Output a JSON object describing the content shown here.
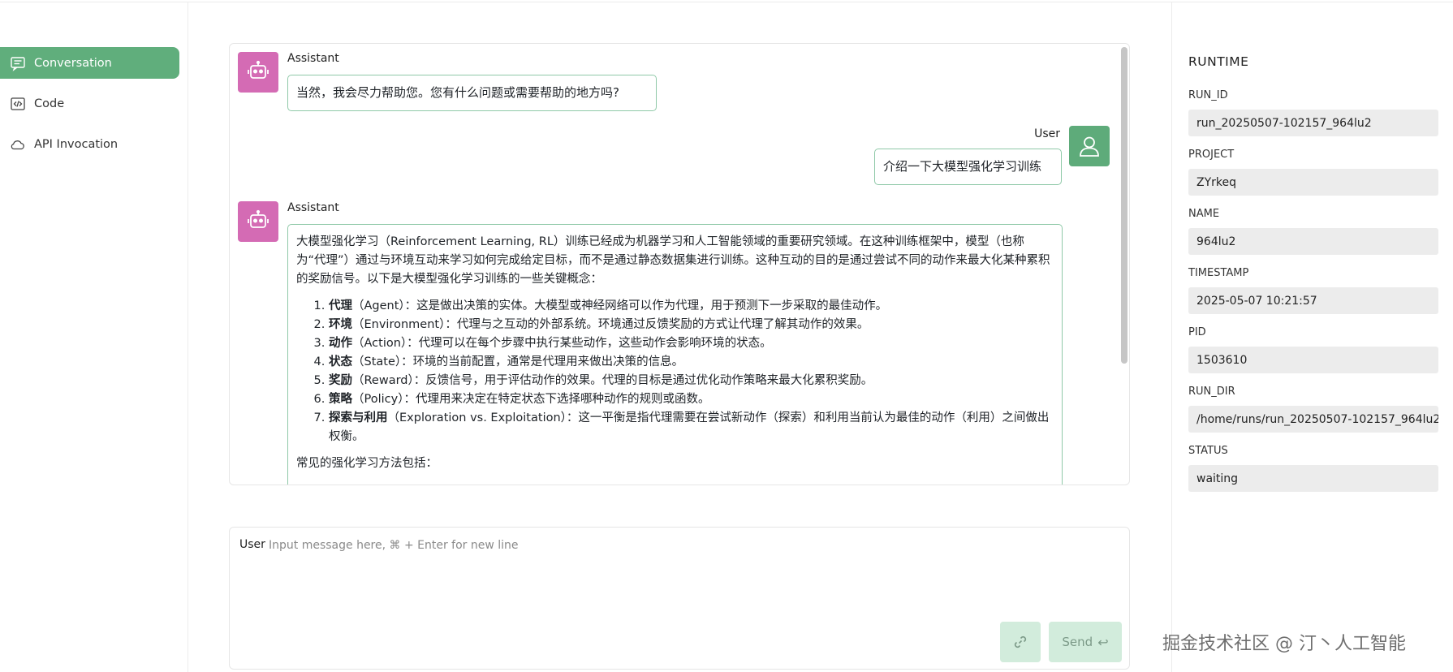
{
  "nav": {
    "items": [
      {
        "label": "Conversation",
        "icon": "chat-icon",
        "active": true
      },
      {
        "label": "Code",
        "icon": "code-icon",
        "active": false
      },
      {
        "label": "API Invocation",
        "icon": "cloud-icon",
        "active": false
      }
    ]
  },
  "chat": {
    "messages": [
      {
        "role": "Assistant",
        "text": "当然，我会尽力帮助您。您有什么问题或需要帮助的地方吗?"
      },
      {
        "role": "User",
        "text": "介绍一下大模型强化学习训练"
      },
      {
        "role": "Assistant",
        "intro": "大模型强化学习（Reinforcement Learning, RL）训练已经成为机器学习和人工智能领域的重要研究领域。在这种训练框架中，模型（也称为“代理”）通过与环境互动来学习如何完成给定目标，而不是通过静态数据集进行训练。这种互动的目的是通过尝试不同的动作来最大化某种累积的奖励信号。以下是大模型强化学习训练的一些关键概念：",
        "list": [
          {
            "term": "代理",
            "en": "（Agent）：",
            "desc": "这是做出决策的实体。大模型或神经网络可以作为代理，用于预测下一步采取的最佳动作。"
          },
          {
            "term": "环境",
            "en": "（Environment）：",
            "desc": "代理与之互动的外部系统。环境通过反馈奖励的方式让代理了解其动作的效果。"
          },
          {
            "term": "动作",
            "en": "（Action）：",
            "desc": "代理可以在每个步骤中执行某些动作，这些动作会影响环境的状态。"
          },
          {
            "term": "状态",
            "en": "（State）：",
            "desc": "环境的当前配置，通常是代理用来做出决策的信息。"
          },
          {
            "term": "奖励",
            "en": "（Reward）：",
            "desc": "反馈信号，用于评估动作的效果。代理的目标是通过优化动作策略来最大化累积奖励。"
          },
          {
            "term": "策略",
            "en": "（Policy）：",
            "desc": "代理用来决定在特定状态下选择哪种动作的规则或函数。"
          },
          {
            "term": "探索与利用",
            "en": "（Exploration vs. Exploitation）：",
            "desc": "这一平衡是指代理需要在尝试新动作（探索）和利用当前认为最佳的动作（利用）之间做出权衡。"
          }
        ],
        "outro": "常见的强化学习方法包括："
      }
    ]
  },
  "input": {
    "label": "User",
    "placeholder": "Input message here, ⌘ + Enter for new line",
    "value": "",
    "send_label": "Send",
    "send_icon": "↩"
  },
  "runtime": {
    "title": "RUNTIME",
    "fields": [
      {
        "label": "RUN_ID",
        "value": "run_20250507-102157_964lu2"
      },
      {
        "label": "PROJECT",
        "value": "ZYrkeq"
      },
      {
        "label": "NAME",
        "value": "964lu2"
      },
      {
        "label": "TIMESTAMP",
        "value": "2025-05-07 10:21:57"
      },
      {
        "label": "PID",
        "value": "1503610"
      },
      {
        "label": "RUN_DIR",
        "value": "/home/runs/run_20250507-102157_964lu2"
      },
      {
        "label": "STATUS",
        "value": "waiting"
      }
    ]
  },
  "watermark": "掘金技术社区 @ 汀丶人工智能",
  "colors": {
    "accent": "#60ae7c",
    "bot_avatar": "#d46bb4",
    "user_avatar": "#5eab7a",
    "button_bg": "#d2ecdc"
  }
}
